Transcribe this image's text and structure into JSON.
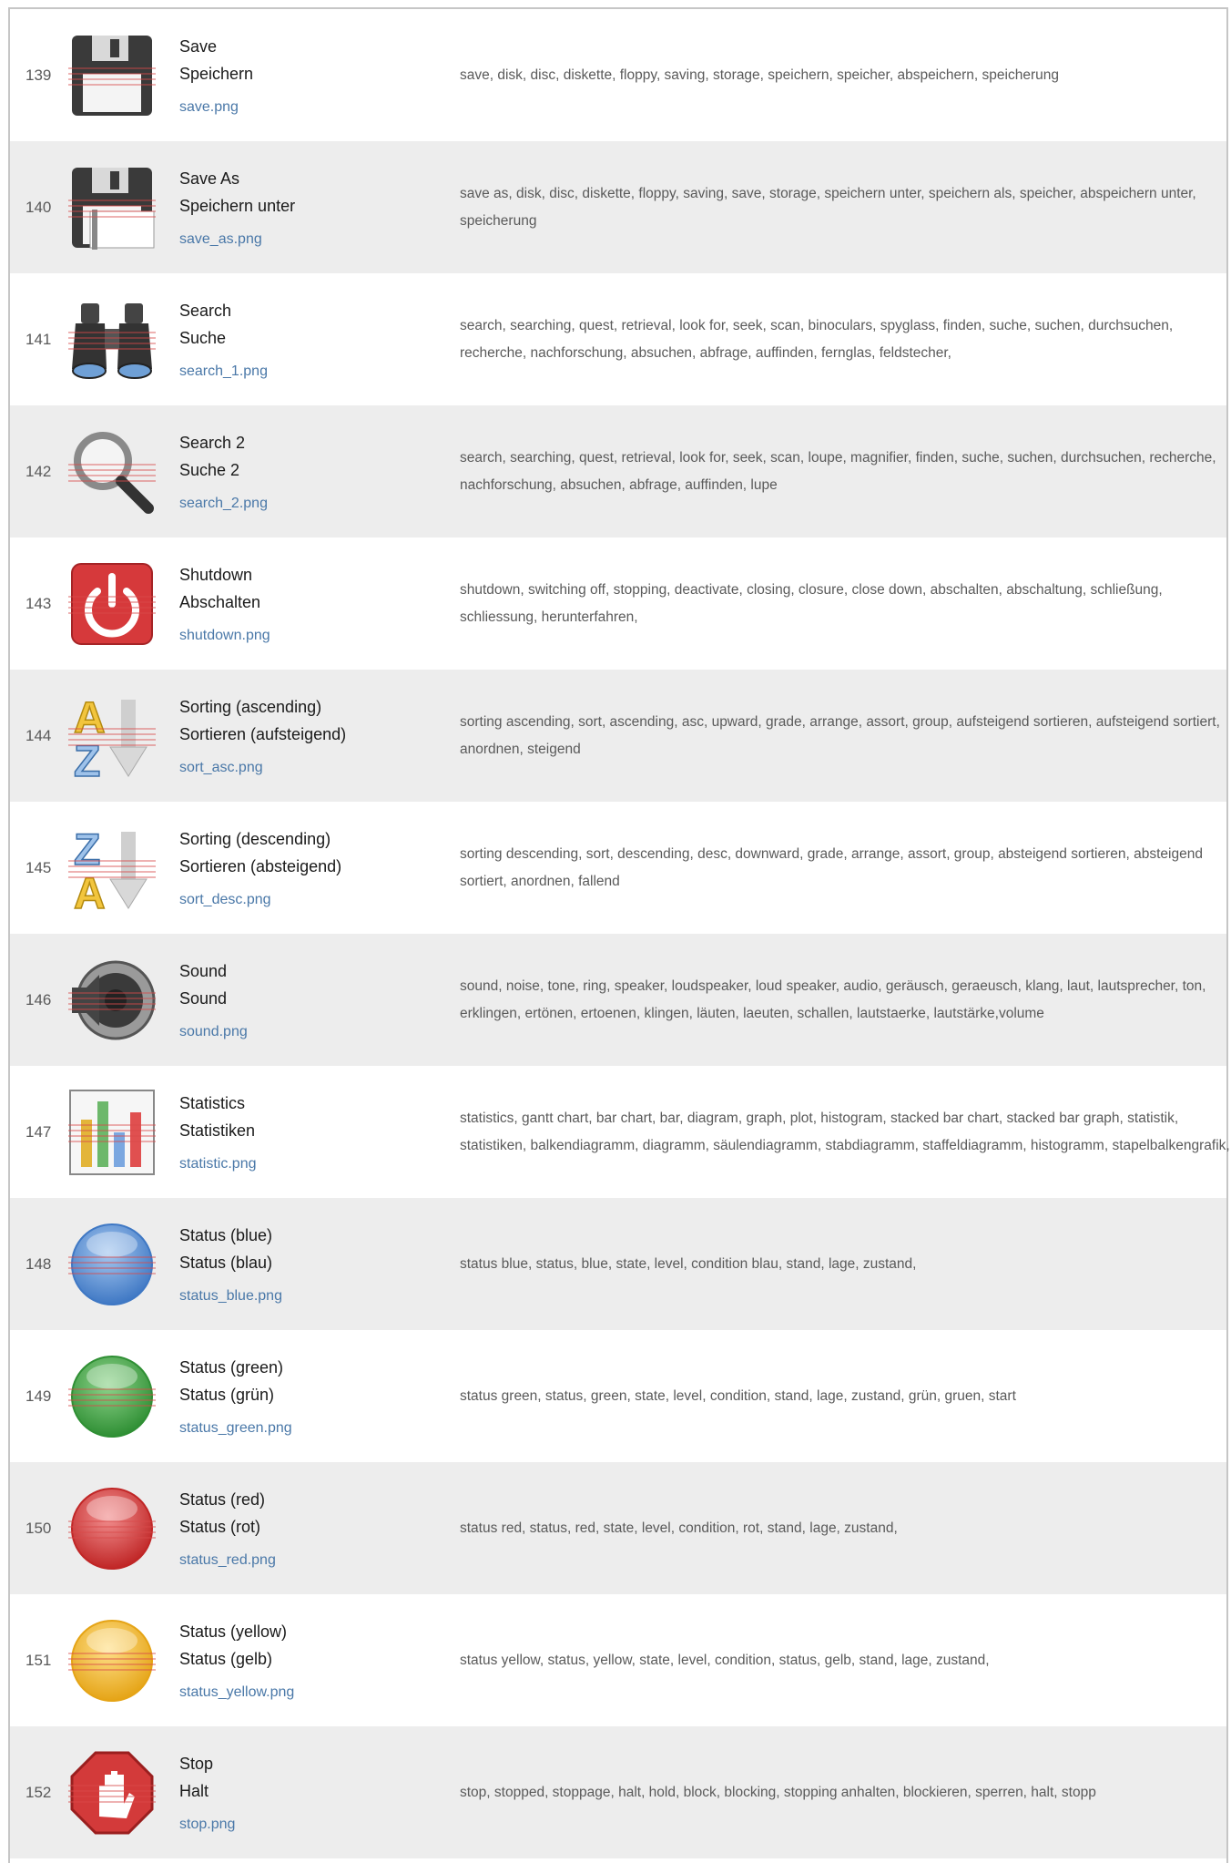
{
  "rows": [
    {
      "num": "139",
      "name_en": "Save",
      "name_de": "Speichern",
      "file": "save.png",
      "icon": "floppy-disk-icon",
      "keywords": "save, disk, disc, diskette, floppy, saving, storage, speichern, speicher, abspeichern, speicherung"
    },
    {
      "num": "140",
      "name_en": "Save As",
      "name_de": "Speichern unter",
      "file": "save_as.png",
      "icon": "floppy-disk-save-as-icon",
      "keywords": "save as, disk, disc, diskette, floppy, saving, save, storage, speichern unter, speichern als, speicher, abspeichern unter, speicherung"
    },
    {
      "num": "141",
      "name_en": "Search",
      "name_de": "Suche",
      "file": "search_1.png",
      "icon": "binoculars-icon",
      "keywords": "search, searching, quest, retrieval, look for, seek, scan, binoculars, spyglass, finden, suche, suchen, durchsuchen, recherche, nachforschung, absuchen, abfrage, auffinden, fernglas, feldstecher,"
    },
    {
      "num": "142",
      "name_en": "Search 2",
      "name_de": "Suche 2",
      "file": "search_2.png",
      "icon": "magnifier-icon",
      "keywords": "search, searching, quest, retrieval, look for, seek, scan, loupe, magnifier, finden, suche, suchen, durchsuchen, recherche, nachforschung, absuchen, abfrage, auffinden, lupe"
    },
    {
      "num": "143",
      "name_en": "Shutdown",
      "name_de": "Abschalten",
      "file": "shutdown.png",
      "icon": "power-icon",
      "keywords": "shutdown, switching off, stopping, deactivate, closing, closure, close down, abschalten, abschaltung, schließung, schliessung, herunterfahren,"
    },
    {
      "num": "144",
      "name_en": "Sorting (ascending)",
      "name_de": "Sortieren (aufsteigend)",
      "file": "sort_asc.png",
      "icon": "sort-ascending-icon",
      "keywords": "sorting ascending, sort, ascending, asc, upward, grade, arrange, assort, group, aufsteigend sortieren, aufsteigend sortiert, anordnen, steigend"
    },
    {
      "num": "145",
      "name_en": "Sorting (descending)",
      "name_de": "Sortieren (absteigend)",
      "file": "sort_desc.png",
      "icon": "sort-descending-icon",
      "keywords": "sorting descending, sort, descending, desc, downward, grade, arrange, assort, group, absteigend sortieren, absteigend sortiert, anordnen, fallend"
    },
    {
      "num": "146",
      "name_en": "Sound",
      "name_de": "Sound",
      "file": "sound.png",
      "icon": "speaker-icon",
      "keywords": "sound, noise, tone, ring, speaker, loudspeaker, loud speaker, audio, geräusch, geraeusch, klang, laut, lautsprecher, ton, erklingen, ertönen, ertoenen, klingen, läuten, laeuten, schallen, lautstaerke, lautstärke,volume"
    },
    {
      "num": "147",
      "name_en": "Statistics",
      "name_de": "Statistiken",
      "file": "statistic.png",
      "icon": "bar-chart-icon",
      "keywords": "statistics, gantt chart, bar chart, bar, diagram, graph, plot, histogram, stacked bar chart, stacked bar graph, statistik, statistiken, balkendiagramm, diagramm, säulendiagramm, stabdiagramm, staffeldiagramm, histogramm, stapelbalkengrafik,"
    },
    {
      "num": "148",
      "name_en": "Status (blue)",
      "name_de": "Status (blau)",
      "file": "status_blue.png",
      "icon": "blue-orb-icon",
      "keywords": "status blue, status, blue, state, level, condition blau, stand, lage, zustand,"
    },
    {
      "num": "149",
      "name_en": "Status (green)",
      "name_de": "Status (grün)",
      "file": "status_green.png",
      "icon": "green-orb-icon",
      "keywords": "status green, status, green, state, level, condition, stand, lage, zustand, grün, gruen, start"
    },
    {
      "num": "150",
      "name_en": "Status (red)",
      "name_de": "Status (rot)",
      "file": "status_red.png",
      "icon": "red-orb-icon",
      "keywords": "status red, status, red, state, level, condition, rot, stand, lage, zustand,"
    },
    {
      "num": "151",
      "name_en": "Status (yellow)",
      "name_de": "Status (gelb)",
      "file": "status_yellow.png",
      "icon": "yellow-orb-icon",
      "keywords": "status yellow, status, yellow, state, level, condition, status, gelb, stand, lage, zustand,"
    },
    {
      "num": "152",
      "name_en": "Stop",
      "name_de": "Halt",
      "file": "stop.png",
      "icon": "stop-hand-icon",
      "keywords": "stop, stopped, stoppage, halt, hold, block, blocking, stopping anhalten, blockieren, sperren, halt, stopp"
    }
  ],
  "colors": {
    "row_alt_bg": "#ededed",
    "link": "#4a78a8",
    "text": "#1a1a1a",
    "muted": "#5a5a5a"
  }
}
